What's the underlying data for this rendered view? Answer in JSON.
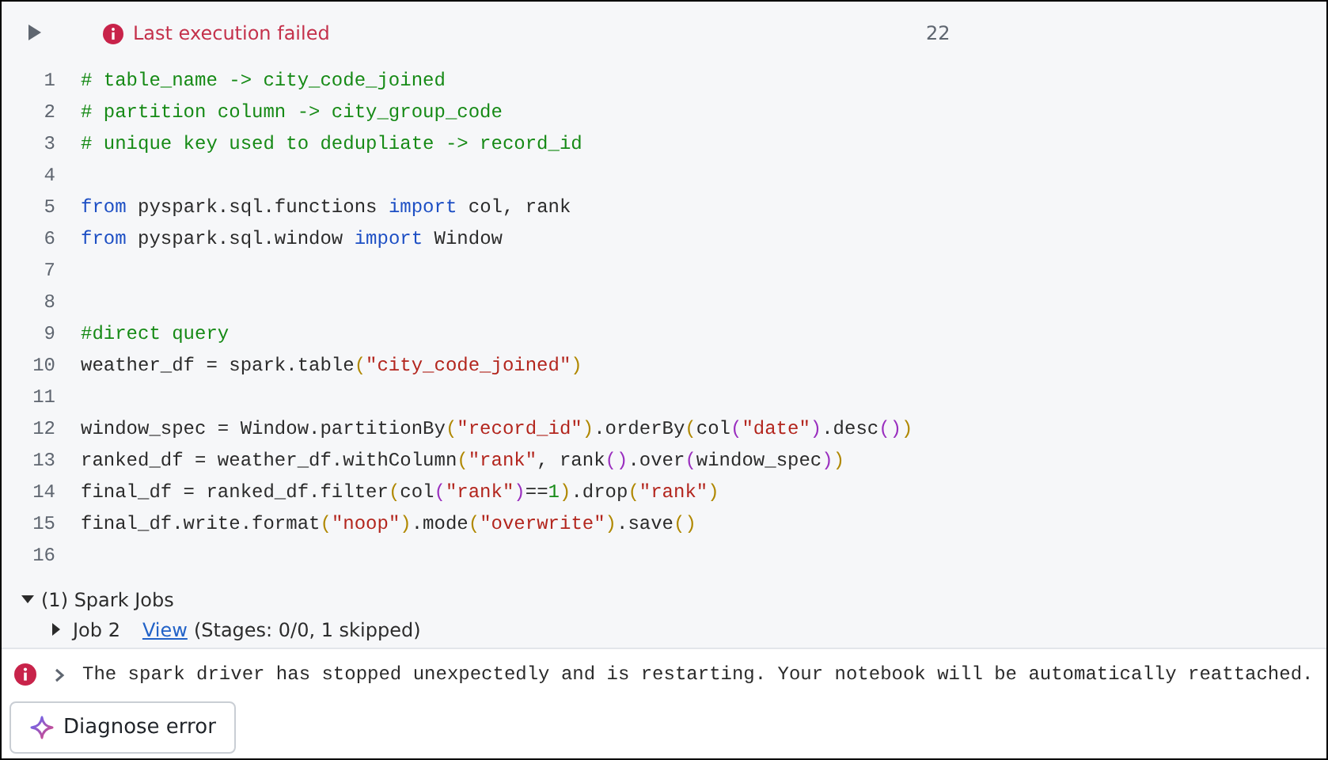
{
  "cell": {
    "status": {
      "text": "Last execution failed"
    },
    "cell_number": "22",
    "lines": [
      {
        "number": "1",
        "tokens": [
          {
            "kind": "comment",
            "text": "# table_name -> city_code_joined"
          }
        ]
      },
      {
        "number": "2",
        "tokens": [
          {
            "kind": "comment",
            "text": "# partition column -> city_group_code"
          }
        ]
      },
      {
        "number": "3",
        "tokens": [
          {
            "kind": "comment",
            "text": "# unique key used to dedupliate -> record_id"
          }
        ]
      },
      {
        "number": "4"
      },
      {
        "number": "5",
        "tokens": [
          {
            "kind": "keyword",
            "text": "from"
          },
          {
            "kind": "plain",
            "text": " pyspark.sql.functions "
          },
          {
            "kind": "keyword",
            "text": "import"
          },
          {
            "kind": "plain",
            "text": " col, rank"
          }
        ]
      },
      {
        "number": "6",
        "tokens": [
          {
            "kind": "keyword",
            "text": "from"
          },
          {
            "kind": "plain",
            "text": " pyspark.sql.window "
          },
          {
            "kind": "keyword",
            "text": "import"
          },
          {
            "kind": "plain",
            "text": " Window"
          }
        ]
      },
      {
        "number": "7"
      },
      {
        "number": "8"
      },
      {
        "number": "9",
        "tokens": [
          {
            "kind": "comment",
            "text": "#direct query"
          }
        ]
      },
      {
        "number": "10",
        "tokens": [
          {
            "kind": "plain",
            "text": "weather_df = spark.table"
          },
          {
            "kind": "paren1",
            "text": "("
          },
          {
            "kind": "string",
            "text": "\"city_code_joined\""
          },
          {
            "kind": "paren1",
            "text": ")"
          }
        ]
      },
      {
        "number": "11"
      },
      {
        "number": "12",
        "tokens": [
          {
            "kind": "plain",
            "text": "window_spec = Window.partitionBy"
          },
          {
            "kind": "paren1",
            "text": "("
          },
          {
            "kind": "string",
            "text": "\"record_id\""
          },
          {
            "kind": "paren1",
            "text": ")"
          },
          {
            "kind": "plain",
            "text": ".orderBy"
          },
          {
            "kind": "paren1",
            "text": "("
          },
          {
            "kind": "plain",
            "text": "col"
          },
          {
            "kind": "paren2",
            "text": "("
          },
          {
            "kind": "string",
            "text": "\"date\""
          },
          {
            "kind": "paren2",
            "text": ")"
          },
          {
            "kind": "plain",
            "text": ".desc"
          },
          {
            "kind": "paren2",
            "text": "()"
          },
          {
            "kind": "paren1",
            "text": ")"
          }
        ]
      },
      {
        "number": "13",
        "tokens": [
          {
            "kind": "plain",
            "text": "ranked_df = weather_df.withColumn"
          },
          {
            "kind": "paren1",
            "text": "("
          },
          {
            "kind": "string",
            "text": "\"rank\""
          },
          {
            "kind": "plain",
            "text": ", rank"
          },
          {
            "kind": "paren2",
            "text": "()"
          },
          {
            "kind": "plain",
            "text": ".over"
          },
          {
            "kind": "paren2",
            "text": "("
          },
          {
            "kind": "plain",
            "text": "window_spec"
          },
          {
            "kind": "paren2",
            "text": ")"
          },
          {
            "kind": "paren1",
            "text": ")"
          }
        ]
      },
      {
        "number": "14",
        "tokens": [
          {
            "kind": "plain",
            "text": "final_df = ranked_df.filter"
          },
          {
            "kind": "paren1",
            "text": "("
          },
          {
            "kind": "plain",
            "text": "col"
          },
          {
            "kind": "paren2",
            "text": "("
          },
          {
            "kind": "string",
            "text": "\"rank\""
          },
          {
            "kind": "paren2",
            "text": ")"
          },
          {
            "kind": "plain",
            "text": "=="
          },
          {
            "kind": "number",
            "text": "1"
          },
          {
            "kind": "paren1",
            "text": ")"
          },
          {
            "kind": "plain",
            "text": ".drop"
          },
          {
            "kind": "paren1",
            "text": "("
          },
          {
            "kind": "string",
            "text": "\"rank\""
          },
          {
            "kind": "paren1",
            "text": ")"
          }
        ]
      },
      {
        "number": "15",
        "tokens": [
          {
            "kind": "plain",
            "text": "final_df.write.format"
          },
          {
            "kind": "paren1",
            "text": "("
          },
          {
            "kind": "string",
            "text": "\"noop\""
          },
          {
            "kind": "paren1",
            "text": ")"
          },
          {
            "kind": "plain",
            "text": ".mode"
          },
          {
            "kind": "paren1",
            "text": "("
          },
          {
            "kind": "string",
            "text": "\"overwrite\""
          },
          {
            "kind": "paren1",
            "text": ")"
          },
          {
            "kind": "plain",
            "text": ".save"
          },
          {
            "kind": "paren1",
            "text": "()"
          }
        ]
      },
      {
        "number": "16"
      }
    ],
    "jobs": {
      "title": "(1) Spark Jobs",
      "expanded": true,
      "items": [
        {
          "name": "Job 2",
          "expanded": false,
          "link": "View",
          "detail": "(Stages: 0/0, 1 skipped)"
        }
      ]
    },
    "error": {
      "expanded": false,
      "message": "The spark driver has stopped unexpectedly and is restarting. Your notebook will be automatically reattached."
    },
    "diagnose_button": "Diagnose error"
  }
}
